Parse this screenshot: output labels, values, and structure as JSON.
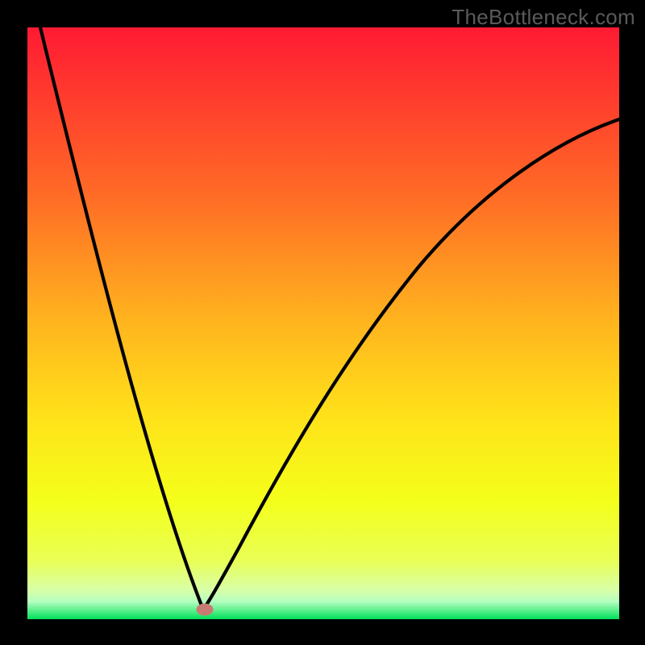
{
  "watermark": "TheBottleneck.com",
  "colors": {
    "frame": "#000000",
    "gradient_top": "#ff1a33",
    "gradient_upper_mid": "#ff8a1f",
    "gradient_mid": "#ffd21a",
    "gradient_lower_mid": "#f6ff1a",
    "gradient_low": "#e4ff4d",
    "gradient_pale": "#d8ffb0",
    "gradient_bottom": "#00e05a",
    "curve_stroke": "#000000",
    "marker_fill": "#c97b73",
    "marker_stroke": "#c97b73"
  },
  "chart_data": {
    "type": "line",
    "title": "",
    "xlabel": "",
    "ylabel": "",
    "xlim": [
      0,
      100
    ],
    "ylim": [
      0,
      100
    ],
    "curve": {
      "description": "V-shaped bottleneck curve with steep left branch and shallower right branch",
      "minimum_at_x": 30,
      "minimum_y": 1,
      "left_branch": {
        "x_start": 2,
        "y_start": 100,
        "x_end": 30,
        "y_end": 1
      },
      "right_branch": {
        "x_start": 30,
        "y_start": 1,
        "x_end": 100,
        "y_end": 77
      }
    },
    "marker": {
      "x": 30,
      "y": 1.5,
      "shape": "ellipse"
    },
    "background_gradient": "vertical red→orange→yellow→green"
  }
}
